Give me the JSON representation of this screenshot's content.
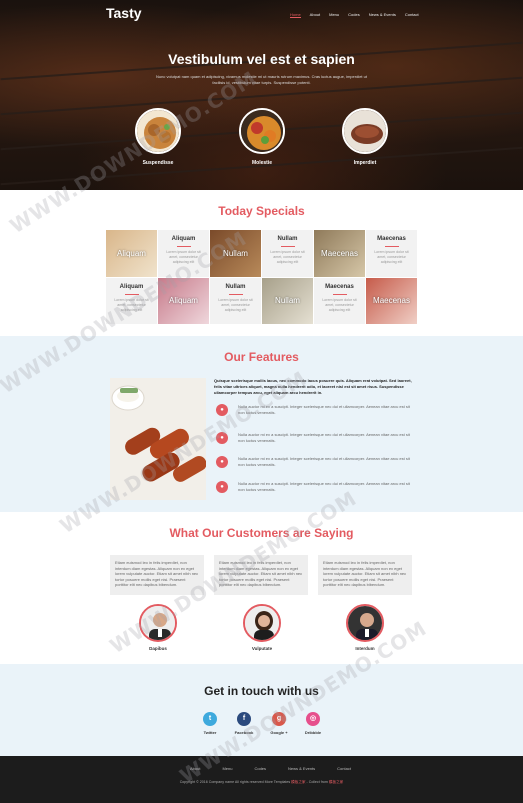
{
  "brand": "Tasty",
  "nav": [
    "Home",
    "About",
    "Menu",
    "Codes",
    "News & Events",
    "Contact"
  ],
  "hero": {
    "title": "Vestibulum vel est et sapien",
    "text": "Nunc volutpat nam quam et adipiscing, vivamus molestie mi ut mauris rutrum maximus. Cras luctus augue, imperdiet ut facilisis id, vestibulum vitae turpis. Suspendisse potenti.",
    "dishes": [
      "Suspendisse",
      "Molestie",
      "Imperdiet"
    ]
  },
  "specials": {
    "title": "Today Specials",
    "photo_overlays": [
      "Aliquam",
      "Nullam",
      "Maecenas",
      "Aliquam",
      "Nullam",
      "Maecenas"
    ],
    "headings": [
      "Aliquam",
      "Nullam",
      "Maecenas",
      "Aliquam",
      "Nullam",
      "Maecenas"
    ],
    "blurb": "Lorem ipsum dolor sit amet, consectetur adipiscing elit"
  },
  "features": {
    "title": "Our Features",
    "intro": "Quisque scelerisque mollis lacus, nec commodo lacus posuere quis. Aliquam erat volutpat. Sed laoreet, felis vitae ultrices aliquet, magna nulla hendrerit odio, et laoreet nisl est sit amet risus. Suspendisse ullamcorper tempus arcu, eget aliquam arcu hendrerit in.",
    "items": [
      "Nulla auctor mi ex a suscipit. Integer scelerisque nec dui et ullamcorper. Aenean vitae arcu est sit non luctus venenatis.",
      "Nulla auctor mi ex a suscipit. Integer scelerisque nec dui et ullamcorper. Aenean vitae arcu est sit non luctus venenatis.",
      "Nulla auctor mi ex a suscipit. Integer scelerisque nec dui et ullamcorper. Aenean vitae arcu est sit non luctus venenatis.",
      "Nulla auctor mi ex a suscipit. Integer scelerisque nec dui et ullamcorper. Aenean vitae arcu est sit non luctus venenatis."
    ]
  },
  "testimonials": {
    "title": "What Our Customers are Saying",
    "quote": "Etiam euismod leo in felis imperdiet, non interdum diam egestas. Aliquam non ex eget lorem vulputate auctor. Etiam sit amet nibh nec tortor posuere mollis eget nisi. Praesent porttitor elit nec dapibus bibendum.",
    "people": [
      "Dapibus",
      "Vulputate",
      "Interdum"
    ]
  },
  "contact": {
    "title": "Get in touch with us",
    "social": [
      "Twitter",
      "Facebook",
      "Google +",
      "Dribbble"
    ],
    "colors": [
      "#3ea9dd",
      "#2b4a7e",
      "#d9574a",
      "#e64f8c"
    ]
  },
  "footer": {
    "nav": [
      "About",
      "Menu",
      "Codes",
      "News & Events",
      "Contact"
    ],
    "copyright": "Copyright © 2016 Company name All rights reserved",
    "template_text": "More Templates",
    "collect_text": "- Collect from",
    "highlight": "模板之家"
  },
  "watermark": "WWW.DOWNDEMO.COM",
  "accent": "#e35b61"
}
